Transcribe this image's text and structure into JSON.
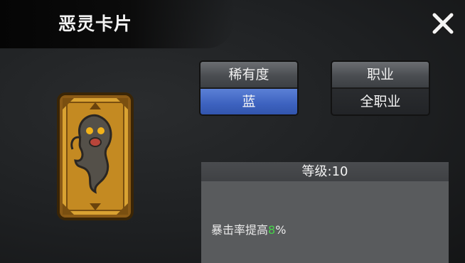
{
  "title": "恶灵卡片",
  "icons": {
    "close": "close-icon",
    "card": "ghost-card-icon"
  },
  "rarity": {
    "label": "稀有度",
    "value": "蓝"
  },
  "job": {
    "label": "职业",
    "value": "全职业"
  },
  "level": {
    "label": "等级:10"
  },
  "effect": {
    "text": "暴击率提高",
    "value": "8",
    "unit": "%"
  },
  "colors": {
    "rarity_blue": "#3d62bf",
    "effect_value": "#46d24a"
  }
}
